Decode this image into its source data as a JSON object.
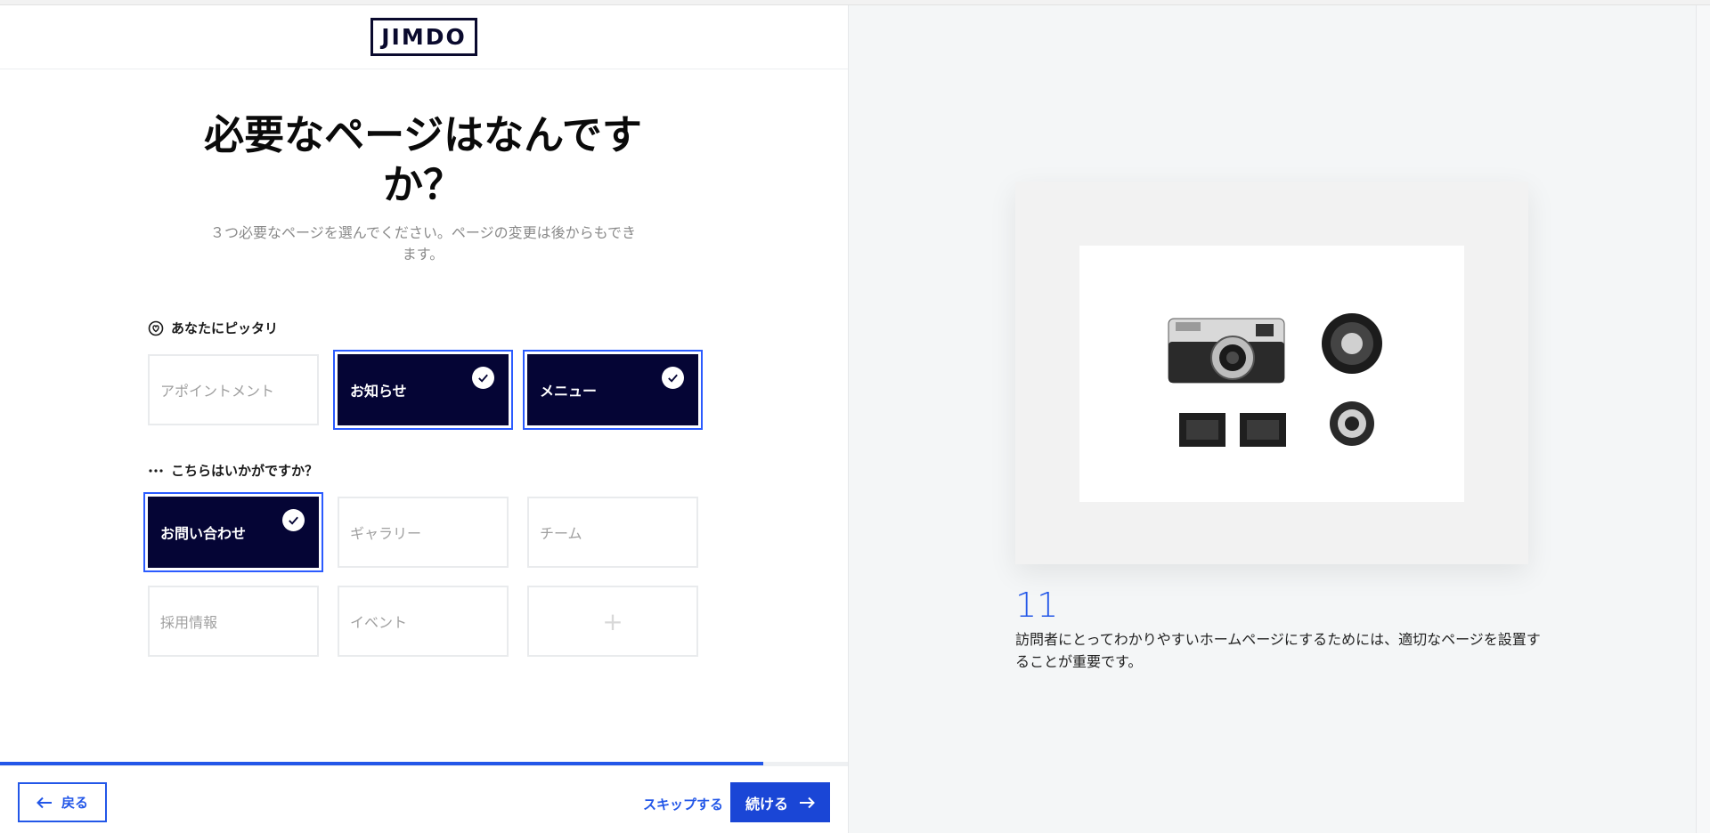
{
  "brand": {
    "logo_text": "JIMDO",
    "accent": "#2357e8",
    "dark": "#050535"
  },
  "question": {
    "title": "必要なページはなんですか？",
    "subtitle": "３つ必要なページを選んでください。ページの変更は後からもできます。"
  },
  "sections": {
    "recommended": {
      "label": "あなたにピッタリ",
      "icon": "user-heart-icon"
    },
    "suggestions": {
      "label": "こちらはいかがですか？",
      "icon": "ellipsis-icon"
    }
  },
  "recommended_cards": [
    {
      "label": "アポイントメント",
      "selected": false
    },
    {
      "label": "お知らせ",
      "selected": true
    },
    {
      "label": "メニュー",
      "selected": true
    }
  ],
  "suggestion_cards": [
    {
      "label": "お問い合わせ",
      "selected": true
    },
    {
      "label": "ギャラリー",
      "selected": false
    },
    {
      "label": "チーム",
      "selected": false
    },
    {
      "label": "採用情報",
      "selected": false
    },
    {
      "label": "イベント",
      "selected": false
    }
  ],
  "add_card": {
    "label": "+"
  },
  "progress": {
    "percent": 90
  },
  "footer": {
    "back_label": "戻る",
    "skip_label": "スキップする",
    "continue_label": "続ける"
  },
  "tip": {
    "number": "11",
    "text": "訪問者にとってわかりやすいホームページにするためには、適切なページを設置することが重要です。"
  }
}
